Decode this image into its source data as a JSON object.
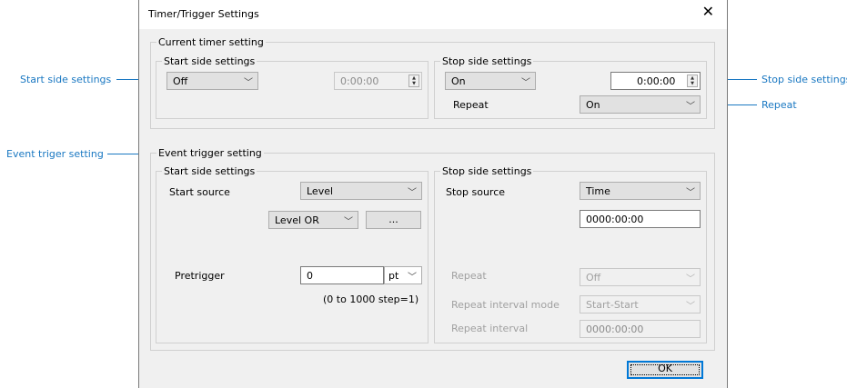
{
  "dialog": {
    "title": "Timer/Trigger Settings"
  },
  "current_timer": {
    "group_label": "Current timer setting",
    "start": {
      "label": "Start side settings",
      "mode": "Off",
      "time": "0:00:00"
    },
    "stop": {
      "label": "Stop side settings",
      "mode": "On",
      "time": "0:00:00",
      "repeat_label": "Repeat",
      "repeat": "On"
    }
  },
  "event_trigger": {
    "group_label": "Event trigger setting",
    "start": {
      "label": "Start side settings",
      "source_label": "Start source",
      "source": "Level",
      "logic": "Level OR",
      "more_button": "...",
      "pretrigger_label": "Pretrigger",
      "pretrigger_value": "0",
      "pretrigger_unit": "pt",
      "range_hint": "(0 to 1000 step=1)"
    },
    "stop": {
      "label": "Stop side settings",
      "source_label": "Stop source",
      "source": "Time",
      "time": "0000:00:00",
      "repeat_label": "Repeat",
      "repeat": "Off",
      "interval_mode_label": "Repeat interval mode",
      "interval_mode": "Start-Start",
      "interval_label": "Repeat interval",
      "interval": "0000:00:00"
    }
  },
  "ok_button": "OK",
  "callouts": {
    "start_side": "Start side settings",
    "event": "Event triger setting",
    "stop_side": "Stop side settings",
    "repeat": "Repeat"
  },
  "colors": {
    "callout": "#1a78c2",
    "dialog_bg": "#f0f0f0",
    "default_button_border": "#0078d7"
  },
  "icons": {
    "close": "close-icon",
    "dropdown": "chevron-down-icon",
    "spin": "spin-updown-icon"
  }
}
